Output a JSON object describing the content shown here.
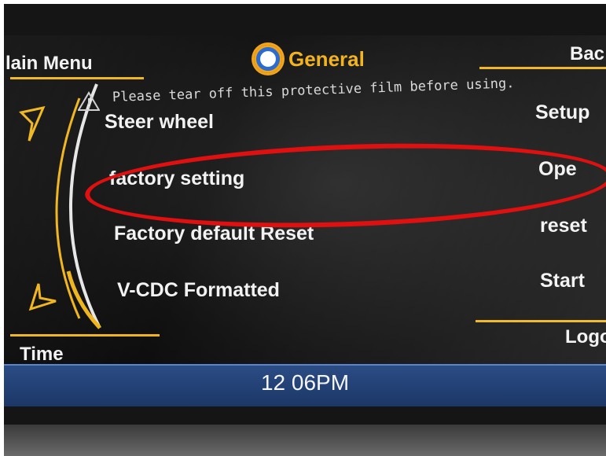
{
  "header": {
    "left_label": "lain Menu",
    "title": "General",
    "right_label": "Bac"
  },
  "notice": {
    "text": "Please tear off this protective film before using."
  },
  "rows": [
    {
      "label": "Steer wheel",
      "action": "Setup"
    },
    {
      "label": "factory setting",
      "action": "Ope"
    },
    {
      "label": "Factory default Reset",
      "action": "reset"
    },
    {
      "label": "V-CDC Formatted",
      "action": "Start"
    }
  ],
  "footer": {
    "left_label": "Time",
    "right_label": "Logo",
    "clock": "12 06PM"
  },
  "colors": {
    "accent": "#f0b419",
    "highlight": "#e01010",
    "timebar": "#2b4c85"
  },
  "icons": {
    "title": "gear-icon",
    "notice": "warning-icon",
    "nav_up": "arrow-up-left-icon",
    "nav_down": "arrow-down-left-icon"
  }
}
